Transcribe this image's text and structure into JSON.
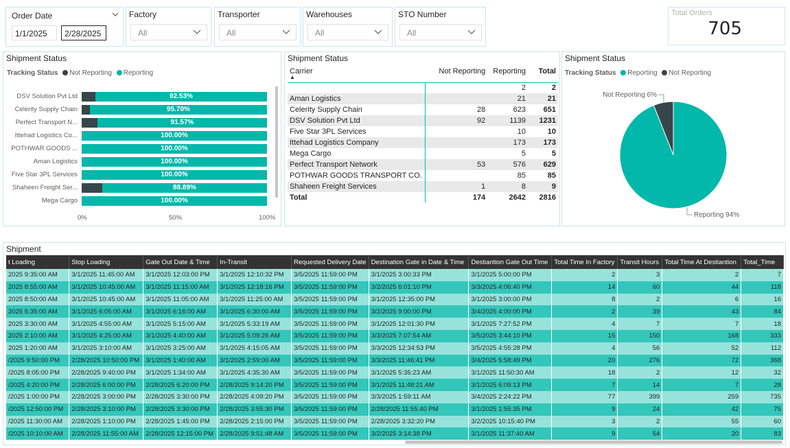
{
  "filters": {
    "order_date": {
      "title": "Order Date",
      "start": "1/1/2025",
      "end": "2/28/2025"
    },
    "factory": {
      "title": "Factory",
      "value": "All"
    },
    "transporter": {
      "title": "Transporter",
      "value": "All"
    },
    "warehouses": {
      "title": "Warehouses",
      "value": "All"
    },
    "sto_number": {
      "title": "STO Number",
      "value": "All"
    }
  },
  "kpi": {
    "title": "Total Orders",
    "value": "705"
  },
  "colors": {
    "reporting": "#01b8aa",
    "not_reporting": "#374649",
    "row_light": "#96e3dc",
    "row_dark": "#33c6bb"
  },
  "bar_visual": {
    "title": "Shipment Status",
    "legend_title": "Tracking Status",
    "legend": [
      "Not Reporting",
      "Reporting"
    ],
    "axis_ticks": [
      "0%",
      "50%",
      "100%"
    ]
  },
  "chart_data": [
    {
      "type": "bar",
      "orientation": "horizontal",
      "stacked": "100%",
      "categories": [
        "DSV Solution Pvt Ltd",
        "Celerity Supply Chain",
        "Perfect Transport N...",
        "Ittehad Logistics Co...",
        "POTHWAR GOODS ...",
        "Aman Logistics",
        "Five Star 3PL Services",
        "Shaheen Freight Ser...",
        "Mega Cargo"
      ],
      "series": [
        {
          "name": "Not Reporting",
          "values": [
            7.47,
            4.3,
            8.43,
            0,
            0,
            0,
            0,
            11.11,
            0
          ]
        },
        {
          "name": "Reporting",
          "values": [
            92.53,
            95.7,
            91.57,
            100,
            100,
            100,
            100,
            88.89,
            100
          ]
        }
      ],
      "data_labels": [
        "92.53%",
        "95.70%",
        "91.57%",
        "100.00%",
        "100.00%",
        "100.00%",
        "100.00%",
        "88.89%",
        "100.00%"
      ],
      "xlim": [
        0,
        100
      ]
    },
    {
      "type": "pie",
      "title": "Shipment Status",
      "legend_title": "Tracking Status",
      "legend": [
        "Reporting",
        "Not Reporting"
      ],
      "slices": [
        {
          "name": "Reporting",
          "value": 94,
          "label": "Reporting 94%"
        },
        {
          "name": "Not Reporting",
          "value": 6,
          "label": "Not Reporting 6%"
        }
      ]
    }
  ],
  "matrix": {
    "title": "Shipment Status",
    "headers": [
      "Carrier",
      "Not Reporting",
      "Reporting",
      "Total"
    ],
    "rows": [
      [
        "",
        "",
        "2",
        "2"
      ],
      [
        "Aman Logistics",
        "",
        "21",
        "21"
      ],
      [
        "Celerity Supply Chain",
        "28",
        "623",
        "651"
      ],
      [
        "DSV Solution Pvt Ltd",
        "92",
        "1139",
        "1231"
      ],
      [
        "Five Star 3PL Services",
        "",
        "10",
        "10"
      ],
      [
        "Ittehad Logistics Company",
        "",
        "173",
        "173"
      ],
      [
        "Mega Cargo",
        "",
        "5",
        "5"
      ],
      [
        "Perfect Transport Network",
        "53",
        "576",
        "629"
      ],
      [
        "POTHWAR GOODS TRANSPORT CO.",
        "",
        "85",
        "85"
      ],
      [
        "Shaheen Freight Services",
        "1",
        "8",
        "9"
      ]
    ],
    "total": [
      "Total",
      "174",
      "2642",
      "2816"
    ]
  },
  "shipment": {
    "title": "Shipment",
    "headers": [
      "t Loading",
      "Stop Loading",
      "Gate Out Date & Time",
      "In-Transit",
      "Requested Delivery Date",
      "Destination Gate in Date & Time",
      "Destiantion Gate Out Time",
      "Total Time In Factory",
      "Transit Hours",
      "Total Time At Destiantion",
      "Total_Time"
    ],
    "rows": [
      [
        "2025 9:35:00 AM",
        "3/1/2025 11:45:00 AM",
        "3/1/2025 12:03:00 PM",
        "3/1/2025 12:10:32 PM",
        "3/5/2025 11:59:00 PM",
        "3/1/2025 3:00:33 PM",
        "3/1/2025 5:00:00 PM",
        "2",
        "3",
        "2",
        "7"
      ],
      [
        "2025 8:55:00 AM",
        "3/1/2025 10:45:00 AM",
        "3/1/2025 11:15:00 AM",
        "3/1/2025 12:18:16 PM",
        "3/5/2025 11:59:00 PM",
        "3/2/2025 6:01:10 PM",
        "3/3/2025 4:06:40 PM",
        "14",
        "60",
        "44",
        "118"
      ],
      [
        "2025 8:50:00 AM",
        "3/1/2025 10:45:00 AM",
        "3/1/2025 11:05:00 AM",
        "3/1/2025 11:25:00 AM",
        "3/5/2025 11:59:00 PM",
        "3/1/2025 12:35:00 PM",
        "3/1/2025 3:00:00 PM",
        "8",
        "2",
        "6",
        "16"
      ],
      [
        "2025 5:35:00 AM",
        "3/1/2025 6:05:00 AM",
        "3/1/2025 6:16:00 AM",
        "3/1/2025 6:30:00 AM",
        "3/5/2025 11:59:00 PM",
        "3/2/2025 9:00:00 PM",
        "3/4/2025 4:00:00 PM",
        "2",
        "39",
        "43",
        "84"
      ],
      [
        "2025 3:30:00 AM",
        "3/1/2025 4:55:00 AM",
        "3/1/2025 5:15:00 AM",
        "3/1/2025 5:33:19 AM",
        "3/5/2025 11:59:00 PM",
        "3/1/2025 12:01:30 PM",
        "3/1/2025 7:27:52 PM",
        "4",
        "7",
        "7",
        "18"
      ],
      [
        "2025 2:10:00 AM",
        "3/1/2025 4:25:00 AM",
        "3/1/2025 4:40:00 AM",
        "3/1/2025 5:09:26 AM",
        "3/5/2025 11:59:00 PM",
        "3/3/2025 7:07:54 AM",
        "3/5/2025 3:44:10 PM",
        "15",
        "150",
        "168",
        "333"
      ],
      [
        "2025 1:20:00 AM",
        "3/1/2025 3:10:00 AM",
        "3/1/2025 3:25:00 AM",
        "3/1/2025 4:15:05 AM",
        "3/5/2025 11:59:00 PM",
        "3/3/2025 12:34:53 PM",
        "3/5/2025 4:55:28 PM",
        "4",
        "56",
        "52",
        "112"
      ],
      [
        "/2025 9:50:00 PM",
        "2/28/2025 10:50:00 PM",
        "3/1/2025 1:40:00 AM",
        "3/1/2025 2:59:00 AM",
        "3/5/2025 11:59:00 PM",
        "3/3/2025 11:46:41 PM",
        "3/4/2025 5:58:49 PM",
        "20",
        "276",
        "72",
        "368"
      ],
      [
        "/2025 8:05:00 PM",
        "2/28/2025 9:40:00 PM",
        "3/1/2025 1:34:00 AM",
        "3/1/2025 4:35:30 AM",
        "3/5/2025 11:59:00 PM",
        "3/1/2025 5:35:23 AM",
        "3/1/2025 11:50:30 AM",
        "18",
        "2",
        "12",
        "32"
      ],
      [
        "/2025 4:20:00 PM",
        "2/28/2025 6:00:00 PM",
        "2/28/2025 6:20:00 PM",
        "2/28/2025 9:14:20 PM",
        "3/5/2025 11:59:00 PM",
        "3/1/2025 11:48:21 AM",
        "3/1/2025 6:09:13 PM",
        "7",
        "14",
        "7",
        "28"
      ],
      [
        "/2025 1:00:00 PM",
        "2/28/2025 3:00:00 PM",
        "2/28/2025 3:30:00 PM",
        "2/28/2025 4:09:20 PM",
        "3/5/2025 11:59:00 PM",
        "3/3/2025 1:59:11 AM",
        "3/4/2025 2:24:22 PM",
        "77",
        "399",
        "259",
        "735"
      ],
      [
        "/2025 12:50:00 PM",
        "2/28/2025 3:10:00 PM",
        "2/28/2025 3:30:00 PM",
        "2/28/2025 3:55:30 PM",
        "3/5/2025 11:59:00 PM",
        "2/28/2025 11:55:40 PM",
        "3/1/2025 1:55:35 PM",
        "9",
        "24",
        "42",
        "75"
      ],
      [
        "/2025 11:30:00 AM",
        "2/28/2025 1:10:00 PM",
        "2/28/2025 1:45:00 PM",
        "2/28/2025 2:15:00 PM",
        "3/5/2025 11:59:00 PM",
        "2/28/2025 3:32:20 PM",
        "3/2/2025 10:15:40 PM",
        "3",
        "2",
        "55",
        "60"
      ],
      [
        "/2025 10:10:00 AM",
        "2/28/2025 11:55:00 AM",
        "2/28/2025 12:15:00 PM",
        "2/28/2025 9:51:48 AM",
        "3/5/2025 11:59:00 PM",
        "3/2/2025 3:14:38 PM",
        "3/1/2025 11:37:40 AM",
        "9",
        "54",
        "20",
        "83"
      ]
    ]
  }
}
